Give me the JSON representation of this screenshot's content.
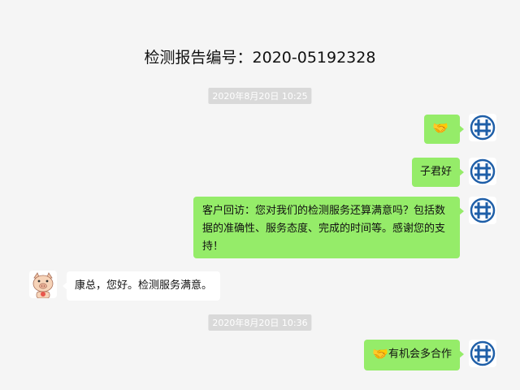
{
  "header": {
    "title": "检测报告编号：2020-05192328"
  },
  "timestamps": [
    "2020年8月20日 10:25",
    "2020年8月20日 10:36"
  ],
  "messages": [
    {
      "emoji": "🤝",
      "text": ""
    },
    {
      "text": "子君好"
    },
    {
      "text": "客户回访：您对我们的检测服务还算满意吗？包括数据的准确性、服务态度、完成的时间等。感谢您的支持！"
    },
    {
      "text": "康总，您好。检测服务满意。"
    },
    {
      "emoji": "🤝",
      "text": "有机会多合作"
    }
  ],
  "icons": {
    "self_avatar": "company-logo-icon",
    "other_avatar": "pig-avatar-icon"
  },
  "colors": {
    "outgoing_bubble": "#95ec69",
    "incoming_bubble": "#ffffff",
    "background": "#f5f5f5",
    "logo_blue": "#1f5fa8"
  }
}
